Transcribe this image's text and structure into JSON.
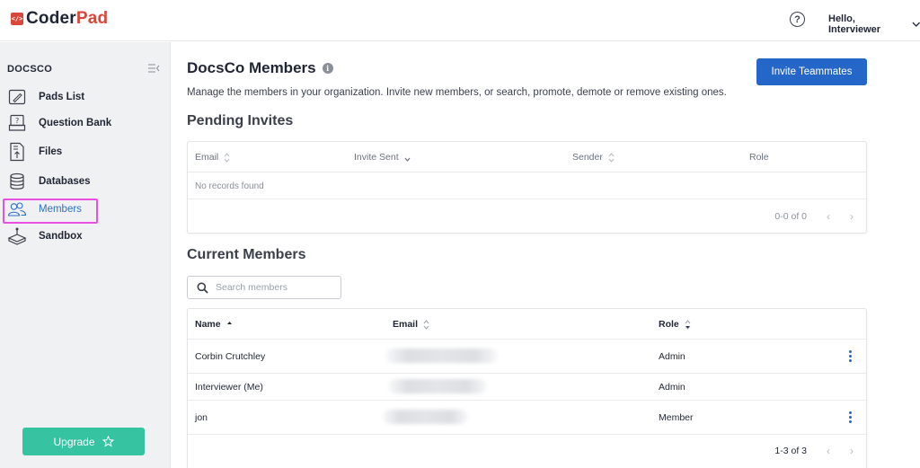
{
  "app": {
    "logo_mark": "</>",
    "logo_word_1": "Coder",
    "logo_word_2": "Pad",
    "help_icon": "?",
    "user_greeting": "Hello, Interviewer"
  },
  "sidebar": {
    "org_name": "DOCSCO",
    "items": [
      {
        "label": "Pads List",
        "icon": "pencil-icon"
      },
      {
        "label": "Question Bank",
        "icon": "question-bank-icon"
      },
      {
        "label": "Files",
        "icon": "file-upload-icon"
      },
      {
        "label": "Databases",
        "icon": "database-icon"
      },
      {
        "label": "Members",
        "icon": "members-icon",
        "active": true
      },
      {
        "label": "Sandbox",
        "icon": "sandbox-icon"
      }
    ],
    "upgrade_label": "Upgrade"
  },
  "main": {
    "title": "DocsCo Members",
    "info_glyph": "i",
    "invite_button": "Invite Teammates",
    "description": "Manage the members in your organization. Invite new members, or search, promote, demote or remove existing ones.",
    "pending": {
      "title": "Pending Invites",
      "columns": [
        "Email",
        "Invite Sent",
        "Sender",
        "Role"
      ],
      "empty_text": "No records found",
      "pagination": "0-0 of 0"
    },
    "current": {
      "title": "Current Members",
      "search_placeholder": "Search members",
      "columns": [
        "Name",
        "Email",
        "Role"
      ],
      "rows": [
        {
          "name": "Corbin Crutchley",
          "role": "Admin",
          "has_menu": true
        },
        {
          "name": "Interviewer (Me)",
          "role": "Admin",
          "has_menu": false
        },
        {
          "name": "jon",
          "role": "Member",
          "has_menu": true
        }
      ],
      "pagination": "1-3 of 3"
    }
  },
  "colors": {
    "accent": "#2467c9",
    "brand_red": "#d9463a",
    "upgrade_green": "#36c3a2",
    "highlight_pink": "#e94fe2"
  }
}
